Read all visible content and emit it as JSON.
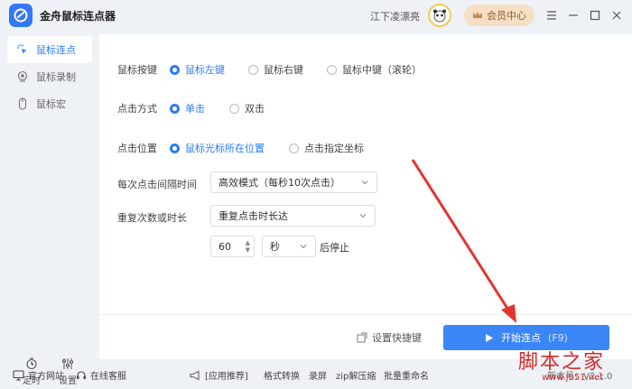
{
  "app": {
    "title": "金舟鼠标连点器",
    "username": "江下凌漂亮",
    "vip_label": "会员中心"
  },
  "sidebar": {
    "items": [
      {
        "label": "鼠标连点",
        "active": true
      },
      {
        "label": "鼠标录制",
        "active": false
      },
      {
        "label": "鼠标宏",
        "active": false
      }
    ],
    "bottom": [
      {
        "label": "定时"
      },
      {
        "label": "设置"
      }
    ]
  },
  "form": {
    "button": {
      "label": "鼠标按键",
      "options": [
        "鼠标左键",
        "鼠标右键",
        "鼠标中键（滚轮）"
      ],
      "selected": 0
    },
    "click_mode": {
      "label": "点击方式",
      "options": [
        "单击",
        "双击"
      ],
      "selected": 0
    },
    "position": {
      "label": "点击位置",
      "options": [
        "鼠标光标所在位置",
        "点击指定坐标"
      ],
      "selected": 0
    },
    "interval": {
      "label": "每次点击间隔时间",
      "value": "高效模式（每秒10次点击）"
    },
    "repeat": {
      "label": "重复次数或时长",
      "value": "重复点击时长达",
      "amount": "60",
      "unit": "秒",
      "suffix": "后停止"
    }
  },
  "actions": {
    "shortcut_label": "设置快捷键",
    "start_label": "开始连点",
    "start_key": "(F9)"
  },
  "footer": {
    "website": "官方网站",
    "support": "在线客服",
    "recommend": "[应用推荐]",
    "links": [
      "格式转换",
      "录屏",
      "zip解压缩",
      "批量重命名"
    ],
    "version": "新本号：V2.1.0"
  },
  "watermark": {
    "text": "脚本之家",
    "url": "www.jb51.net"
  },
  "colors": {
    "accent": "#3b86f7",
    "annotation_arrow": "#e3342f"
  }
}
